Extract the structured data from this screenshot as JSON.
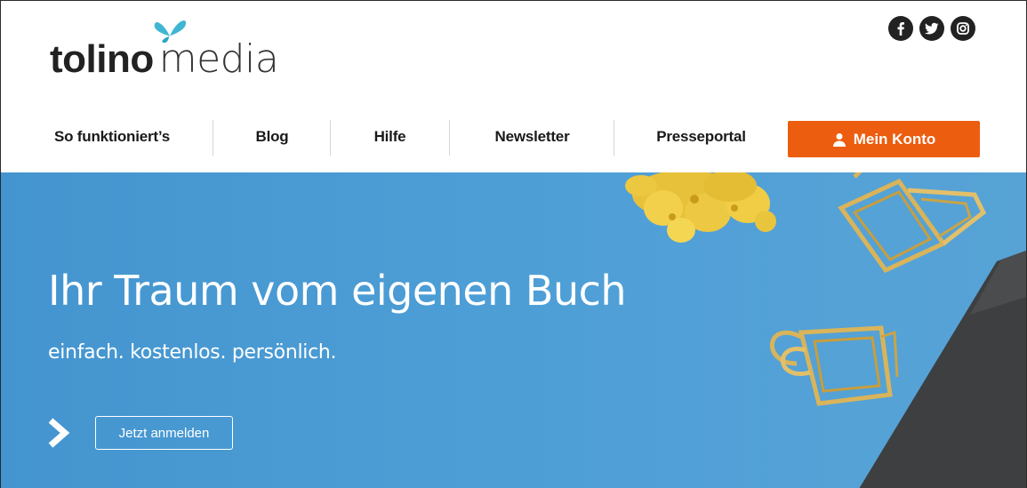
{
  "logo": {
    "bold": "tolino",
    "light": "media"
  },
  "social": [
    {
      "icon": "facebook-icon"
    },
    {
      "icon": "twitter-icon"
    },
    {
      "icon": "instagram-icon"
    }
  ],
  "nav": {
    "items": [
      {
        "label": "So funktioniert’s"
      },
      {
        "label": "Blog"
      },
      {
        "label": "Hilfe"
      },
      {
        "label": "Newsletter"
      },
      {
        "label": "Presseportal"
      }
    ],
    "account_label": "Mein Konto",
    "account_icon": "user-icon"
  },
  "hero": {
    "title": "Ihr Traum vom eigenen Buch",
    "subtitle": "einfach. kostenlos. persönlich.",
    "cta_label": "Jetzt anmelden"
  },
  "colors": {
    "accent": "#ec5d0f",
    "hero_blue": "#4a9ad3",
    "butterfly": "#3fb6d3"
  }
}
